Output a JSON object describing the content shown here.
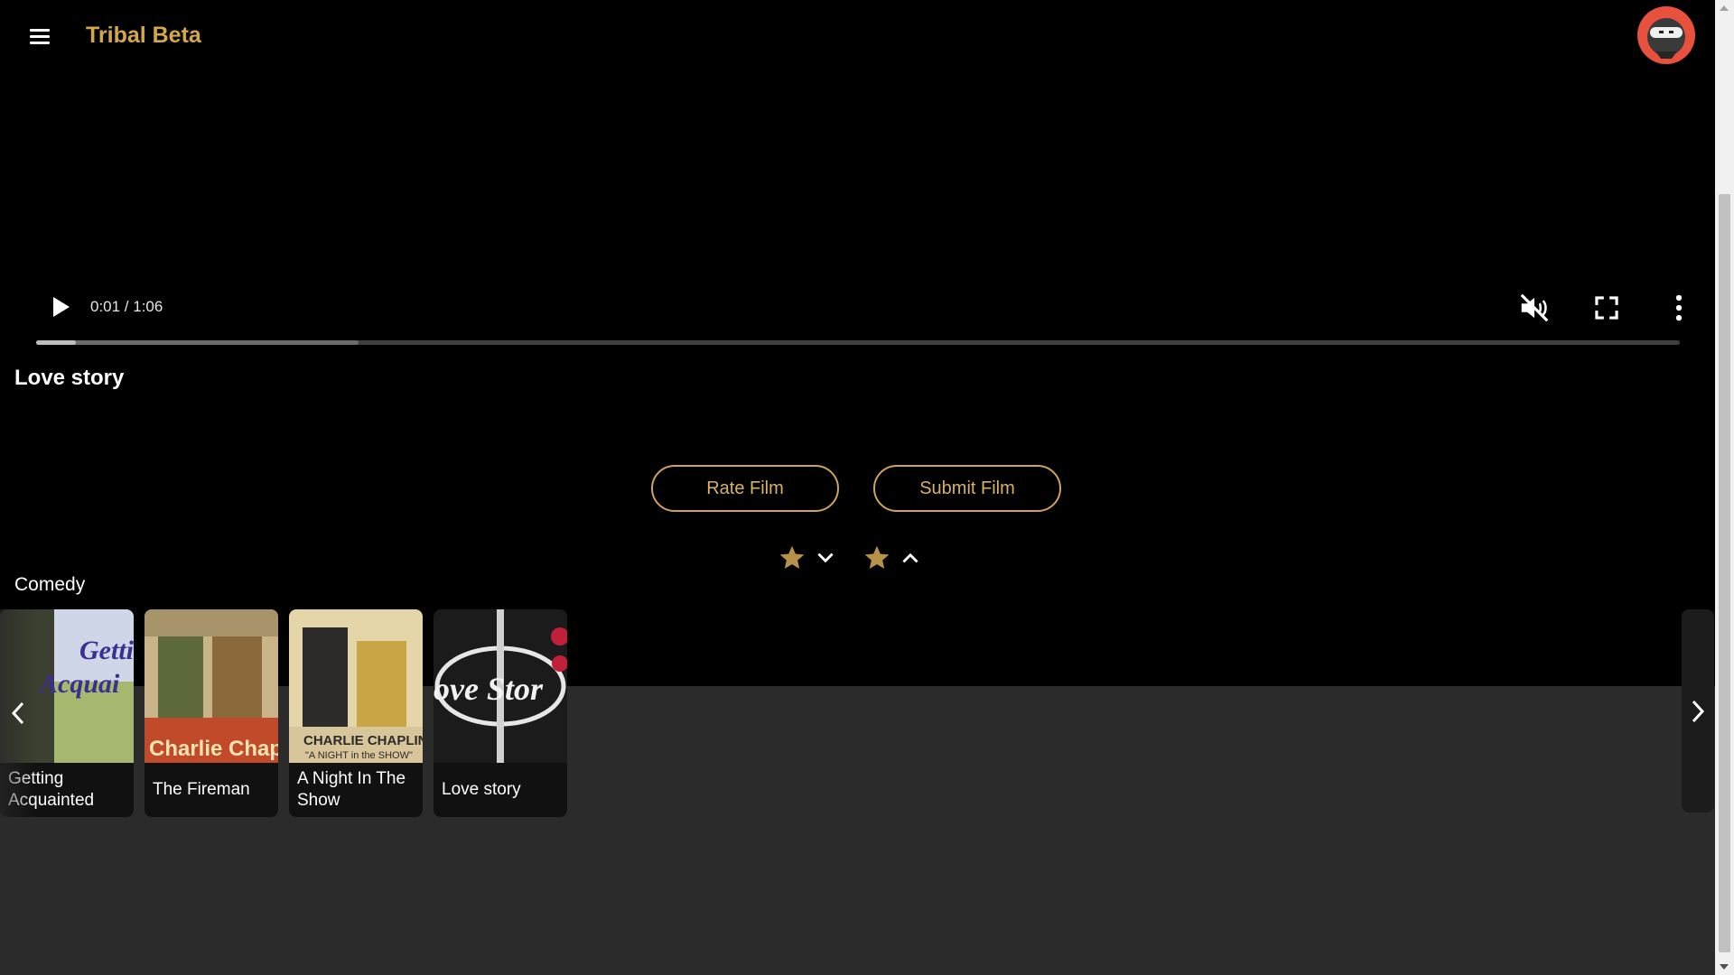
{
  "app": {
    "title": "Tribal Beta"
  },
  "player": {
    "time": "0:01 / 1:06",
    "played_fraction": 0.024,
    "buffered_fraction": 0.196,
    "muted": true
  },
  "film": {
    "title": "Love story"
  },
  "actions": {
    "rate_label": "Rate Film",
    "submit_label": "Submit Film"
  },
  "sort": {
    "items": [
      {
        "icon": "star-icon",
        "direction": "descending"
      },
      {
        "icon": "star-icon",
        "direction": "ascending"
      }
    ]
  },
  "category": {
    "name": "Comedy",
    "films": [
      {
        "title": "Getting Acquainted",
        "poster_text": "Getting Acquainted"
      },
      {
        "title": "The Fireman",
        "poster_text": "Charlie Chaplin"
      },
      {
        "title": "A Night In The Show",
        "poster_text": "CHARLIE CHAPLIN \"A NIGHT in the SHOW\""
      },
      {
        "title": "Love story",
        "poster_text": "Love Story"
      }
    ]
  },
  "colors": {
    "accent": "#d4a84a",
    "button_border": "#cfa35a",
    "avatar": "#e8513d",
    "lower_background": "#2b2b2b"
  }
}
